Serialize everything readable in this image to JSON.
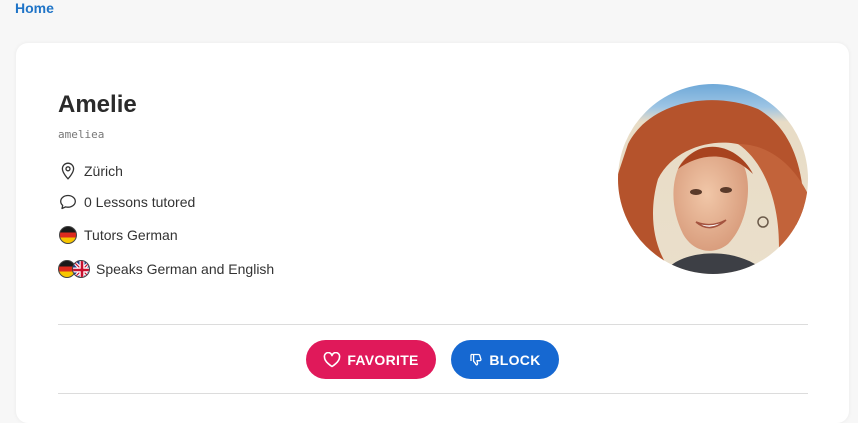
{
  "breadcrumb": {
    "home_label": "Home"
  },
  "profile": {
    "name": "Amelie",
    "username": "ameliea",
    "location": "Zürich",
    "lessons": "0 Lessons tutored",
    "tutors": "Tutors German",
    "speaks": "Speaks German and English"
  },
  "actions": {
    "favorite_label": "FAVORITE",
    "block_label": "BLOCK"
  },
  "colors": {
    "link": "#1f74c7",
    "favorite": "#e0195a",
    "block": "#1668d1"
  },
  "icons": [
    "map-pin-icon",
    "chat-bubble-icon",
    "german-flag-icon",
    "uk-flag-icon",
    "heart-icon",
    "thumbs-down-icon"
  ]
}
